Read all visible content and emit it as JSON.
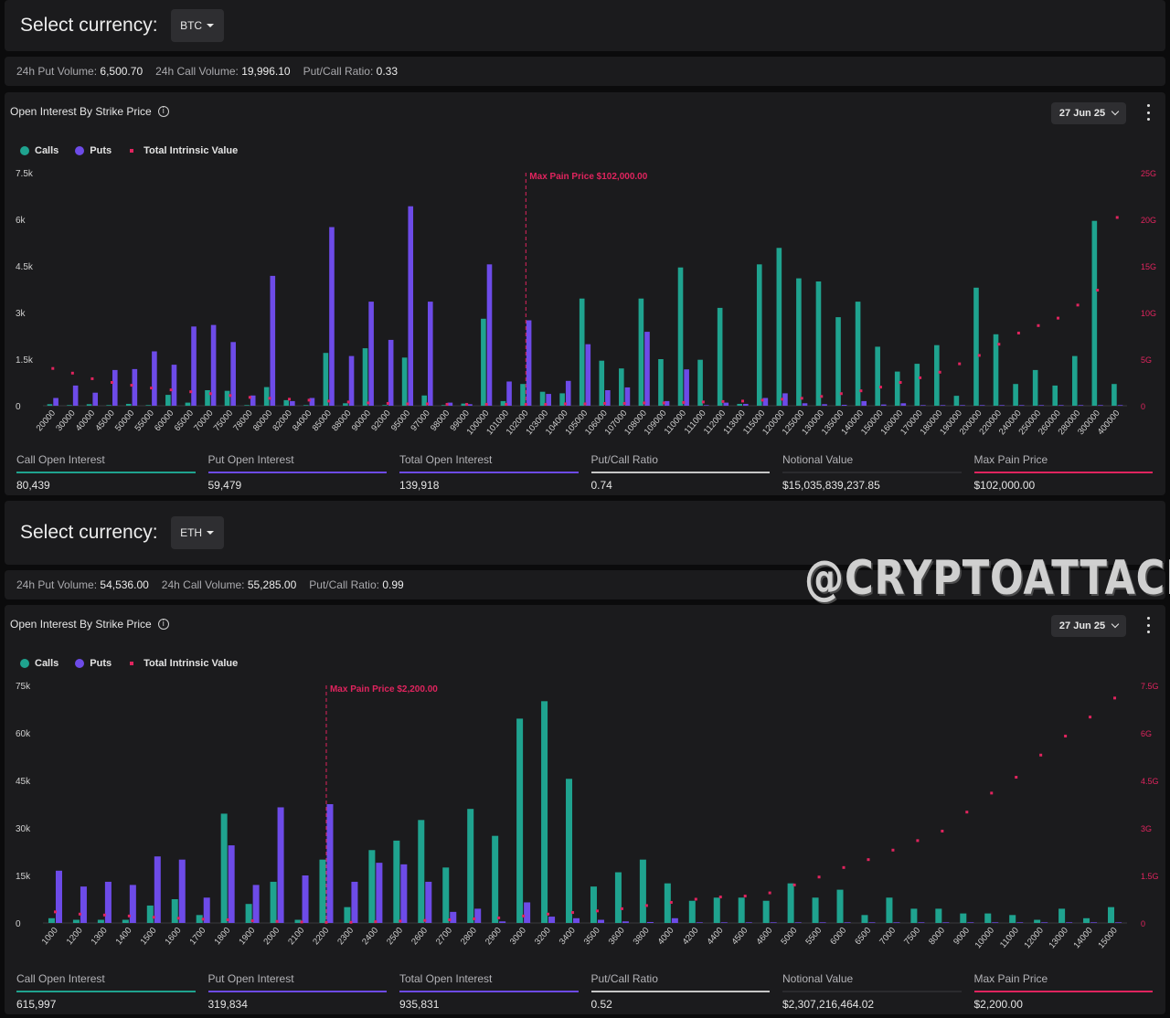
{
  "colors": {
    "calls": "#1fa38f",
    "puts": "#6d4be8",
    "intrinsic": "#e0245e",
    "calls_bar": "#1fa38f",
    "puts_bar": "#6d4be8",
    "total_bar": "#6d4be8",
    "ratio_bar": "#c6c6c6",
    "notional_bar": "#2b2b2e",
    "maxpain_bar": "#e0245e"
  },
  "sections": [
    {
      "select_label": "Select currency:",
      "currency": "BTC",
      "volume": {
        "put_label": "24h Put Volume:",
        "put_value": "6,500.70",
        "call_label": "24h Call Volume:",
        "call_value": "19,996.10",
        "ratio_label": "Put/Call Ratio:",
        "ratio_value": "0.33"
      },
      "chart_title": "Open Interest By Strike Price",
      "expiry": "27 Jun 25",
      "legend": {
        "calls": "Calls",
        "puts": "Puts",
        "intrinsic": "Total Intrinsic Value"
      },
      "max_pain_label": "Max Pain Price $102,000.00",
      "stats": [
        {
          "label": "Call Open Interest",
          "value": "80,439"
        },
        {
          "label": "Put Open Interest",
          "value": "59,479"
        },
        {
          "label": "Total Open Interest",
          "value": "139,918"
        },
        {
          "label": "Put/Call Ratio",
          "value": "0.74"
        },
        {
          "label": "Notional Value",
          "value": "$15,035,839,237.85"
        },
        {
          "label": "Max Pain Price",
          "value": "$102,000.00"
        }
      ]
    },
    {
      "select_label": "Select currency:",
      "currency": "ETH",
      "volume": {
        "put_label": "24h Put Volume:",
        "put_value": "54,536.00",
        "call_label": "24h Call Volume:",
        "call_value": "55,285.00",
        "ratio_label": "Put/Call Ratio:",
        "ratio_value": "0.99"
      },
      "chart_title": "Open Interest By Strike Price",
      "expiry": "27 Jun 25",
      "legend": {
        "calls": "Calls",
        "puts": "Puts",
        "intrinsic": "Total Intrinsic Value"
      },
      "max_pain_label": "Max Pain Price $2,200.00",
      "stats": [
        {
          "label": "Call Open Interest",
          "value": "615,997"
        },
        {
          "label": "Put Open Interest",
          "value": "319,834"
        },
        {
          "label": "Total Open Interest",
          "value": "935,831"
        },
        {
          "label": "Put/Call Ratio",
          "value": "0.52"
        },
        {
          "label": "Notional Value",
          "value": "$2,307,216,464.02"
        },
        {
          "label": "Max Pain Price",
          "value": "$2,200.00"
        }
      ]
    }
  ],
  "watermark": "@CRYPTOATTACK",
  "chart_data": [
    {
      "type": "bar",
      "title": "Open Interest By Strike Price",
      "categories": [
        "20000",
        "30000",
        "40000",
        "45000",
        "50000",
        "55000",
        "60000",
        "65000",
        "70000",
        "75000",
        "78000",
        "80000",
        "82000",
        "84000",
        "85000",
        "88000",
        "90000",
        "92000",
        "95000",
        "97000",
        "98000",
        "99000",
        "100000",
        "101000",
        "102000",
        "103000",
        "104000",
        "105000",
        "106000",
        "107000",
        "108000",
        "109000",
        "110000",
        "111000",
        "112000",
        "113000",
        "115000",
        "120000",
        "125000",
        "130000",
        "135000",
        "140000",
        "150000",
        "160000",
        "170000",
        "180000",
        "190000",
        "200000",
        "220000",
        "240000",
        "250000",
        "260000",
        "280000",
        "300000",
        "400000"
      ],
      "series": [
        {
          "name": "Calls",
          "values": [
            50,
            20,
            50,
            20,
            60,
            20,
            350,
            100,
            500,
            480,
            20,
            600,
            180,
            20,
            1700,
            80,
            1850,
            20,
            1550,
            330,
            20,
            70,
            2800,
            150,
            700,
            450,
            400,
            3450,
            1450,
            1200,
            3450,
            1500,
            4450,
            1480,
            3150,
            60,
            4550,
            5080,
            4100,
            4000,
            2850,
            3350,
            1900,
            1100,
            1350,
            1950,
            320,
            3800,
            2300,
            700,
            1150,
            650,
            1600,
            5950,
            700
          ]
        },
        {
          "name": "Puts",
          "values": [
            250,
            650,
            420,
            1150,
            1180,
            1750,
            1320,
            2550,
            2600,
            2050,
            330,
            4180,
            150,
            250,
            5750,
            1600,
            3350,
            2120,
            6420,
            3350,
            100,
            50,
            4550,
            780,
            2750,
            380,
            800,
            1980,
            500,
            590,
            2380,
            150,
            1170,
            20,
            100,
            60,
            250,
            400,
            80,
            50,
            30,
            150,
            40,
            80,
            20,
            20,
            20,
            20,
            20,
            20,
            20,
            20,
            20,
            20,
            20
          ]
        },
        {
          "name": "Total Intrinsic Value",
          "axis": "right",
          "values": [
            4.0,
            3.5,
            2.9,
            2.5,
            2.2,
            1.9,
            1.7,
            1.5,
            1.3,
            1.1,
            0.9,
            0.8,
            0.7,
            0.6,
            0.5,
            0.4,
            0.3,
            0.25,
            0.2,
            0.2,
            0.15,
            0.15,
            0.15,
            0.15,
            0.15,
            0.15,
            0.2,
            0.2,
            0.25,
            0.25,
            0.3,
            0.3,
            0.35,
            0.4,
            0.45,
            0.5,
            0.6,
            0.7,
            0.8,
            1.0,
            1.3,
            1.6,
            2.0,
            2.5,
            3.0,
            3.6,
            4.5,
            5.4,
            6.6,
            7.8,
            8.6,
            9.4,
            10.8,
            12.4,
            20.2
          ]
        }
      ],
      "ylim": [
        0,
        7500
      ],
      "yticks": [
        "0",
        "1.5k",
        "3k",
        "4.5k",
        "6k",
        "7.5k"
      ],
      "y2lim": [
        0,
        25
      ],
      "y2ticks": [
        "0",
        "5G",
        "10G",
        "15G",
        "20G",
        "25G"
      ],
      "max_pain_index": 24,
      "legend_position": "top-left",
      "grid": false
    },
    {
      "type": "bar",
      "title": "Open Interest By Strike Price",
      "categories": [
        "1000",
        "1200",
        "1300",
        "1400",
        "1500",
        "1600",
        "1700",
        "1800",
        "1900",
        "2000",
        "2100",
        "2200",
        "2300",
        "2400",
        "2500",
        "2600",
        "2700",
        "2800",
        "2900",
        "3000",
        "3200",
        "3400",
        "3500",
        "3600",
        "3800",
        "4000",
        "4200",
        "4400",
        "4500",
        "4600",
        "5000",
        "5500",
        "6000",
        "6500",
        "7000",
        "7500",
        "8000",
        "9000",
        "10000",
        "11000",
        "12000",
        "13000",
        "14000",
        "15000"
      ],
      "series": [
        {
          "name": "Calls",
          "values": [
            1500,
            1000,
            1000,
            1000,
            5500,
            7500,
            2500,
            34500,
            6000,
            13000,
            1000,
            20000,
            5000,
            23000,
            26000,
            32500,
            17500,
            36000,
            27500,
            64500,
            70000,
            45500,
            11500,
            16000,
            20000,
            12500,
            7000,
            8000,
            8000,
            7000,
            12500,
            8000,
            10500,
            2500,
            8000,
            4500,
            4500,
            3000,
            3000,
            2500,
            1000,
            4500,
            1500,
            5000
          ]
        },
        {
          "name": "Puts",
          "values": [
            16500,
            11500,
            13000,
            12000,
            21000,
            20000,
            8000,
            24500,
            12000,
            36500,
            15000,
            37500,
            13000,
            19000,
            18500,
            13000,
            3500,
            4500,
            500,
            6500,
            2000,
            1500,
            1000,
            500,
            300,
            1500,
            200,
            200,
            200,
            200,
            200,
            200,
            200,
            200,
            200,
            200,
            200,
            200,
            200,
            200,
            200,
            200,
            200,
            200
          ]
        },
        {
          "name": "Total Intrinsic Value",
          "axis": "right",
          "values": [
            0.35,
            0.28,
            0.25,
            0.22,
            0.18,
            0.15,
            0.12,
            0.1,
            0.07,
            0.05,
            0.03,
            0.02,
            0.02,
            0.04,
            0.06,
            0.08,
            0.1,
            0.13,
            0.16,
            0.22,
            0.28,
            0.33,
            0.38,
            0.45,
            0.55,
            0.65,
            0.75,
            0.82,
            0.85,
            0.95,
            1.2,
            1.45,
            1.75,
            2.0,
            2.3,
            2.6,
            2.9,
            3.5,
            4.1,
            4.6,
            5.3,
            5.9,
            6.5,
            7.1
          ]
        }
      ],
      "ylim": [
        0,
        75000
      ],
      "yticks": [
        "0",
        "15k",
        "30k",
        "45k",
        "60k",
        "75k"
      ],
      "y2lim": [
        0,
        7.5
      ],
      "y2ticks": [
        "0",
        "1.5G",
        "3G",
        "4.5G",
        "6G",
        "7.5G"
      ],
      "max_pain_index": 11,
      "legend_position": "top-left",
      "grid": false
    }
  ]
}
